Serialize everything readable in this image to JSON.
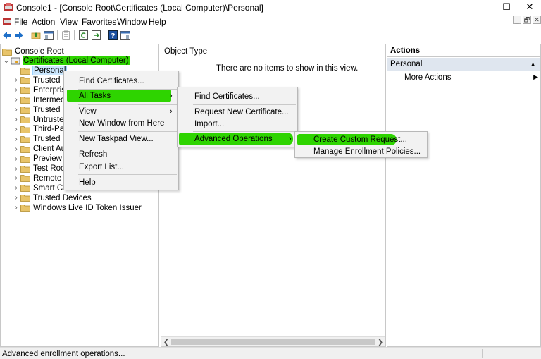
{
  "window": {
    "title": "Console1 - [Console Root\\Certificates (Local Computer)\\Personal]",
    "minimize_glyph": "—",
    "maximize_glyph": "☐",
    "close_glyph": "✕"
  },
  "menubar": {
    "items": [
      "File",
      "Action",
      "View",
      "Favorites",
      "Window",
      "Help"
    ],
    "mdi": [
      "_",
      "🗗",
      "✕"
    ]
  },
  "toolbar": {
    "icons": [
      "back-arrow-icon",
      "forward-arrow-icon",
      "up-folder-icon",
      "show-hide-tree-icon",
      "properties-icon",
      "refresh-icon",
      "export-list-icon",
      "help-icon",
      "show-hide-action-pane-icon"
    ]
  },
  "tree": {
    "root": "Console Root",
    "certificates": "Certificates (Local Computer)",
    "children": [
      "Personal",
      "Trusted F",
      "Enterpris",
      "Intermed",
      "Trusted P",
      "Untruste",
      "Third-Pa",
      "Trusted P",
      "Client Au",
      "Preview E",
      "Test Root",
      "Remote D",
      "Smart Ca",
      "Trusted Devices",
      "Windows Live ID Token Issuer"
    ]
  },
  "center": {
    "column_header": "Object Type",
    "empty_message": "There are no items to show in this view."
  },
  "actions": {
    "header": "Actions",
    "section": "Personal",
    "more_actions": "More Actions"
  },
  "context_menu_1": {
    "items": [
      "Find Certificates...",
      "All Tasks",
      "View",
      "New Window from Here",
      "New Taskpad View...",
      "Refresh",
      "Export List...",
      "Help"
    ]
  },
  "context_menu_2": {
    "items": [
      "Find Certificates...",
      "Request New Certificate...",
      "Import...",
      "Advanced Operations"
    ]
  },
  "context_menu_3": {
    "items": [
      "Create Custom Request...",
      "Manage Enrollment Policies..."
    ]
  },
  "status": {
    "text": "Advanced enrollment operations..."
  },
  "colors": {
    "highlight": "#2ed400",
    "folder": "#e8c46a",
    "selection": "#cce8ff"
  }
}
